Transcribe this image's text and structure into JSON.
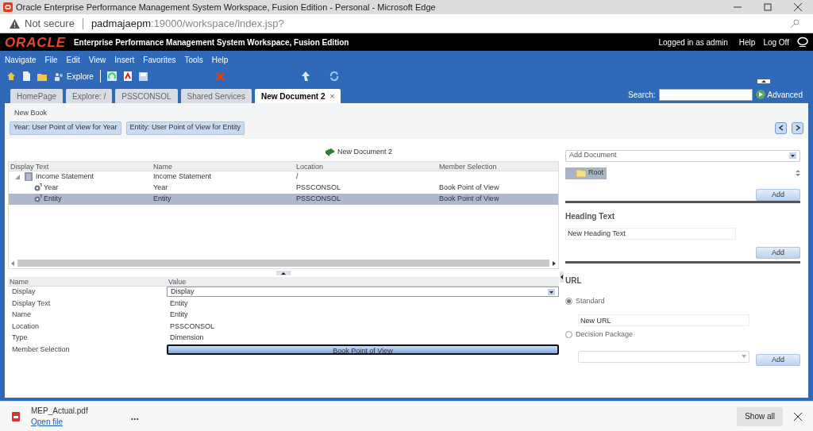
{
  "window": {
    "title": "Oracle Enterprise Performance Management System Workspace, Fusion Edition - Personal - Microsoft Edge"
  },
  "address_bar": {
    "security": "Not secure",
    "url_host": "padmajaepm",
    "url_rest": ":19000/workspace/index.jsp?"
  },
  "header": {
    "logo": "ORACLE",
    "app_title": "Enterprise Performance Management System Workspace, Fusion Edition",
    "user": "Logged in as admin",
    "links": [
      "Help",
      "Log Off"
    ]
  },
  "menu": [
    "Navigate",
    "File",
    "Edit",
    "View",
    "Insert",
    "Favorites",
    "Tools",
    "Help"
  ],
  "toolbar": {
    "explore": "Explore"
  },
  "tabs": [
    {
      "label": "HomePage",
      "selected": false
    },
    {
      "label": "Explore: /",
      "selected": false
    },
    {
      "label": "PSSCONSOL",
      "selected": false
    },
    {
      "label": "Shared Services",
      "selected": false
    },
    {
      "label": "New Document 2",
      "selected": true,
      "close": "×"
    }
  ],
  "search": {
    "label": "Search:",
    "advanced": "Advanced"
  },
  "book": {
    "title": "New Book",
    "pov_buttons": [
      "Year: User Point of View for Year",
      "Entity: User Point of View for Entity"
    ],
    "document_title": "New Document 2"
  },
  "contents": {
    "columns": [
      "Display Text",
      "Name",
      "Location",
      "Member Selection"
    ],
    "rows": [
      {
        "cells": [
          "Income Statement",
          "Income Statement",
          "/",
          ""
        ],
        "selected": false,
        "expanded": true,
        "children": [
          {
            "cells": [
              "Year",
              "Year",
              "PSSCONSOL",
              "Book Point of View"
            ],
            "selected": false
          },
          {
            "cells": [
              "Entity",
              "Entity",
              "PSSCONSOL",
              "Book Point of View"
            ],
            "selected": true
          }
        ]
      }
    ]
  },
  "properties": {
    "columns": [
      "Name",
      "Value"
    ],
    "rows": [
      {
        "name": "Display",
        "value": "Display",
        "kind": "dropdown"
      },
      {
        "name": "Display Text",
        "value": "Entity",
        "kind": "text"
      },
      {
        "name": "Name",
        "value": "Entity",
        "kind": "text"
      },
      {
        "name": "Location",
        "value": "PSSCONSOL",
        "kind": "text"
      },
      {
        "name": "Type",
        "value": "Dimension",
        "kind": "text"
      },
      {
        "name": "Member Selection",
        "value": "Book Point of View",
        "kind": "button"
      }
    ]
  },
  "side_panel": {
    "add_document": "Add Document",
    "tree_root": "Root",
    "add": "Add",
    "heading": {
      "title": "Heading Text",
      "value": "New Heading Text",
      "add": "Add"
    },
    "url": {
      "title": "URL",
      "options": [
        {
          "label": "Standard",
          "selected": true,
          "value": "New URL"
        },
        {
          "label": "Decision Package",
          "selected": false
        }
      ],
      "add": "Add"
    }
  },
  "downloads": {
    "file": "MEP_Actual.pdf",
    "action": "Open file",
    "more": "...",
    "show_all": "Show all"
  }
}
